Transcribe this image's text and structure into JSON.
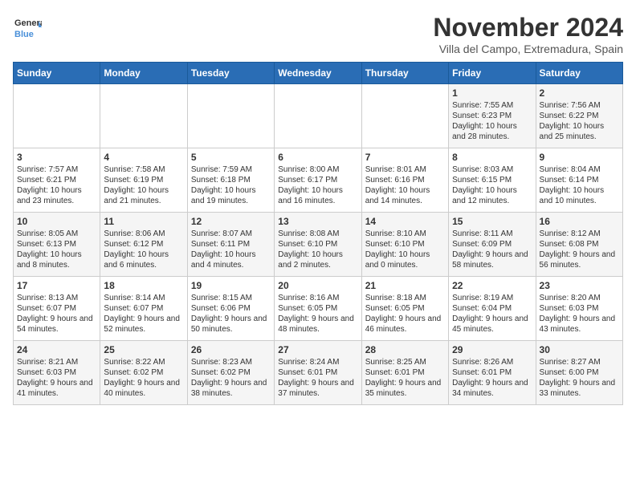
{
  "header": {
    "logo_general": "General",
    "logo_blue": "Blue",
    "month_title": "November 2024",
    "subtitle": "Villa del Campo, Extremadura, Spain"
  },
  "days_of_week": [
    "Sunday",
    "Monday",
    "Tuesday",
    "Wednesday",
    "Thursday",
    "Friday",
    "Saturday"
  ],
  "weeks": [
    [
      {
        "day": "",
        "info": ""
      },
      {
        "day": "",
        "info": ""
      },
      {
        "day": "",
        "info": ""
      },
      {
        "day": "",
        "info": ""
      },
      {
        "day": "",
        "info": ""
      },
      {
        "day": "1",
        "info": "Sunrise: 7:55 AM\nSunset: 6:23 PM\nDaylight: 10 hours and 28 minutes."
      },
      {
        "day": "2",
        "info": "Sunrise: 7:56 AM\nSunset: 6:22 PM\nDaylight: 10 hours and 25 minutes."
      }
    ],
    [
      {
        "day": "3",
        "info": "Sunrise: 7:57 AM\nSunset: 6:21 PM\nDaylight: 10 hours and 23 minutes."
      },
      {
        "day": "4",
        "info": "Sunrise: 7:58 AM\nSunset: 6:19 PM\nDaylight: 10 hours and 21 minutes."
      },
      {
        "day": "5",
        "info": "Sunrise: 7:59 AM\nSunset: 6:18 PM\nDaylight: 10 hours and 19 minutes."
      },
      {
        "day": "6",
        "info": "Sunrise: 8:00 AM\nSunset: 6:17 PM\nDaylight: 10 hours and 16 minutes."
      },
      {
        "day": "7",
        "info": "Sunrise: 8:01 AM\nSunset: 6:16 PM\nDaylight: 10 hours and 14 minutes."
      },
      {
        "day": "8",
        "info": "Sunrise: 8:03 AM\nSunset: 6:15 PM\nDaylight: 10 hours and 12 minutes."
      },
      {
        "day": "9",
        "info": "Sunrise: 8:04 AM\nSunset: 6:14 PM\nDaylight: 10 hours and 10 minutes."
      }
    ],
    [
      {
        "day": "10",
        "info": "Sunrise: 8:05 AM\nSunset: 6:13 PM\nDaylight: 10 hours and 8 minutes."
      },
      {
        "day": "11",
        "info": "Sunrise: 8:06 AM\nSunset: 6:12 PM\nDaylight: 10 hours and 6 minutes."
      },
      {
        "day": "12",
        "info": "Sunrise: 8:07 AM\nSunset: 6:11 PM\nDaylight: 10 hours and 4 minutes."
      },
      {
        "day": "13",
        "info": "Sunrise: 8:08 AM\nSunset: 6:10 PM\nDaylight: 10 hours and 2 minutes."
      },
      {
        "day": "14",
        "info": "Sunrise: 8:10 AM\nSunset: 6:10 PM\nDaylight: 10 hours and 0 minutes."
      },
      {
        "day": "15",
        "info": "Sunrise: 8:11 AM\nSunset: 6:09 PM\nDaylight: 9 hours and 58 minutes."
      },
      {
        "day": "16",
        "info": "Sunrise: 8:12 AM\nSunset: 6:08 PM\nDaylight: 9 hours and 56 minutes."
      }
    ],
    [
      {
        "day": "17",
        "info": "Sunrise: 8:13 AM\nSunset: 6:07 PM\nDaylight: 9 hours and 54 minutes."
      },
      {
        "day": "18",
        "info": "Sunrise: 8:14 AM\nSunset: 6:07 PM\nDaylight: 9 hours and 52 minutes."
      },
      {
        "day": "19",
        "info": "Sunrise: 8:15 AM\nSunset: 6:06 PM\nDaylight: 9 hours and 50 minutes."
      },
      {
        "day": "20",
        "info": "Sunrise: 8:16 AM\nSunset: 6:05 PM\nDaylight: 9 hours and 48 minutes."
      },
      {
        "day": "21",
        "info": "Sunrise: 8:18 AM\nSunset: 6:05 PM\nDaylight: 9 hours and 46 minutes."
      },
      {
        "day": "22",
        "info": "Sunrise: 8:19 AM\nSunset: 6:04 PM\nDaylight: 9 hours and 45 minutes."
      },
      {
        "day": "23",
        "info": "Sunrise: 8:20 AM\nSunset: 6:03 PM\nDaylight: 9 hours and 43 minutes."
      }
    ],
    [
      {
        "day": "24",
        "info": "Sunrise: 8:21 AM\nSunset: 6:03 PM\nDaylight: 9 hours and 41 minutes."
      },
      {
        "day": "25",
        "info": "Sunrise: 8:22 AM\nSunset: 6:02 PM\nDaylight: 9 hours and 40 minutes."
      },
      {
        "day": "26",
        "info": "Sunrise: 8:23 AM\nSunset: 6:02 PM\nDaylight: 9 hours and 38 minutes."
      },
      {
        "day": "27",
        "info": "Sunrise: 8:24 AM\nSunset: 6:01 PM\nDaylight: 9 hours and 37 minutes."
      },
      {
        "day": "28",
        "info": "Sunrise: 8:25 AM\nSunset: 6:01 PM\nDaylight: 9 hours and 35 minutes."
      },
      {
        "day": "29",
        "info": "Sunrise: 8:26 AM\nSunset: 6:01 PM\nDaylight: 9 hours and 34 minutes."
      },
      {
        "day": "30",
        "info": "Sunrise: 8:27 AM\nSunset: 6:00 PM\nDaylight: 9 hours and 33 minutes."
      }
    ]
  ]
}
